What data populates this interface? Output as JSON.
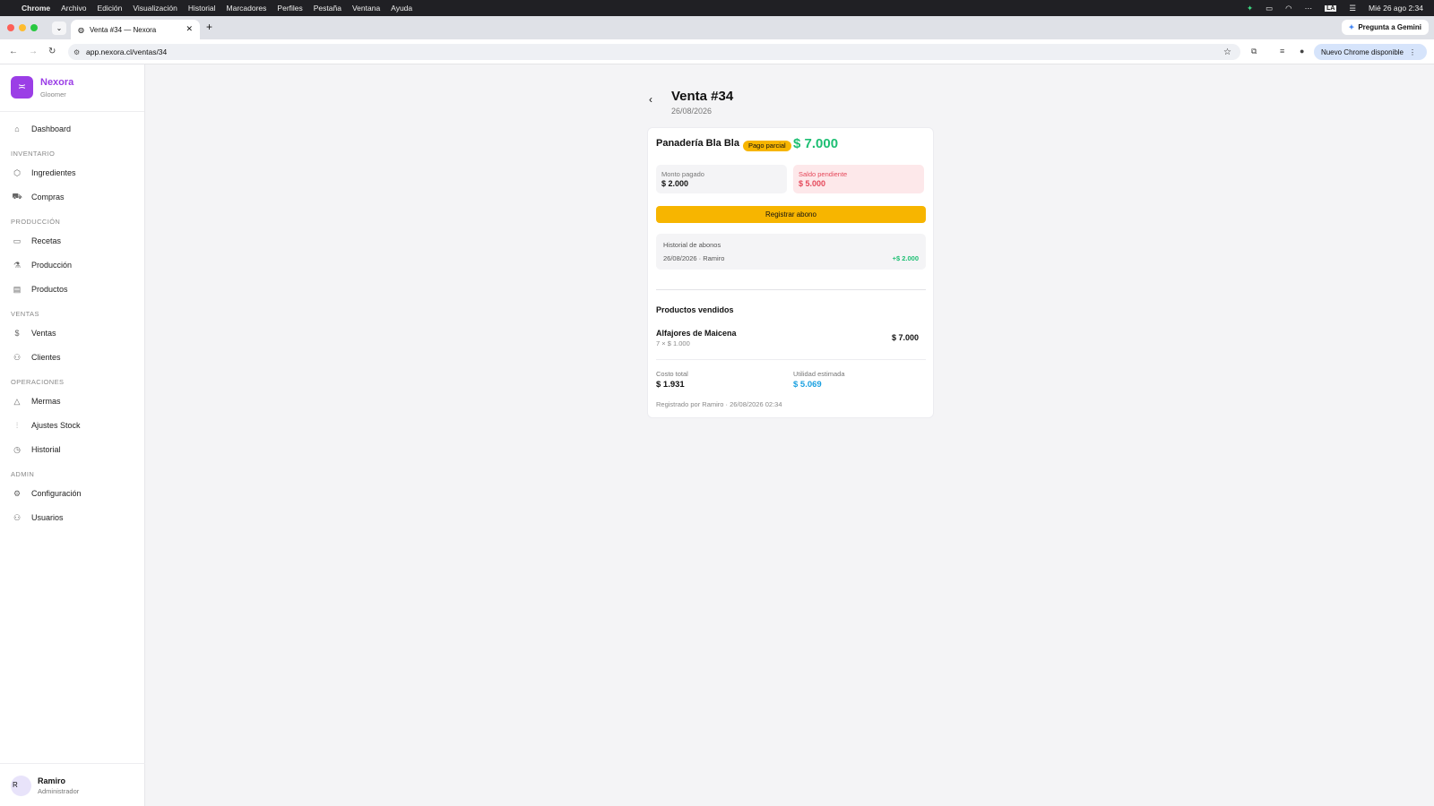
{
  "os_menubar": {
    "apple": "",
    "app": "Chrome",
    "items": [
      "Archivo",
      "Edición",
      "Visualización",
      "Historial",
      "Marcadores",
      "Perfiles",
      "Pestaña",
      "Ventana",
      "Ayuda"
    ],
    "input_source": "LA",
    "datetime": "Mié 26 ago 2:34"
  },
  "browser": {
    "tab_title": "Venta #34 — Nexora",
    "url": "app.nexora.cl/ventas/34",
    "gemini_label": "Pregunta a Gemini",
    "update_label": "Nuevo Chrome disponible"
  },
  "sidebar": {
    "brand_name": "Nexora",
    "brand_sub": "Gloomer",
    "dashboard": "Dashboard",
    "sections": {
      "inventario": "INVENTARIO",
      "produccion": "PRODUCCIÓN",
      "ventas": "VENTAS",
      "operaciones": "OPERACIONES",
      "admin": "ADMIN"
    },
    "items": {
      "ingredientes": "Ingredientes",
      "compras": "Compras",
      "recetas": "Recetas",
      "produccion": "Producción",
      "productos": "Productos",
      "ventas": "Ventas",
      "clientes": "Clientes",
      "mermas": "Mermas",
      "ajustes": "Ajustes Stock",
      "historial": "Historial",
      "configuracion": "Configuración",
      "usuarios": "Usuarios"
    },
    "user": {
      "initial": "R",
      "name": "Ramiro",
      "role": "Administrador"
    }
  },
  "sale": {
    "title": "Venta #34",
    "date": "26/08/2026",
    "client": "Panadería Bla Bla",
    "status": "Pago parcial",
    "total": "$ 7.000",
    "paid_label": "Monto pagado",
    "paid_value": "$ 2.000",
    "pending_label": "Saldo pendiente",
    "pending_value": "$ 5.000",
    "register_button": "Registrar abono",
    "history_title": "Historial de abonos",
    "history": [
      {
        "date": "26/08/2026 · Ramiro",
        "amount": "+$ 2.000"
      }
    ],
    "products_title": "Productos vendidos",
    "products": [
      {
        "name": "Alfajores de Maicena",
        "qty": "7 × $ 1.000",
        "subtotal": "$ 7.000"
      }
    ],
    "cost_label": "Costo total",
    "cost_value": "$ 1.931",
    "profit_label": "Utilidad estimada",
    "profit_value": "$ 5.069",
    "registered": "Registrado por Ramiro · 26/08/2026 02:34"
  },
  "colors": {
    "brand": "#9b3ee6",
    "accent": "#f7b500",
    "positive": "#1dbf73",
    "pending": "#e5485a",
    "profit": "#1aa0e0"
  }
}
